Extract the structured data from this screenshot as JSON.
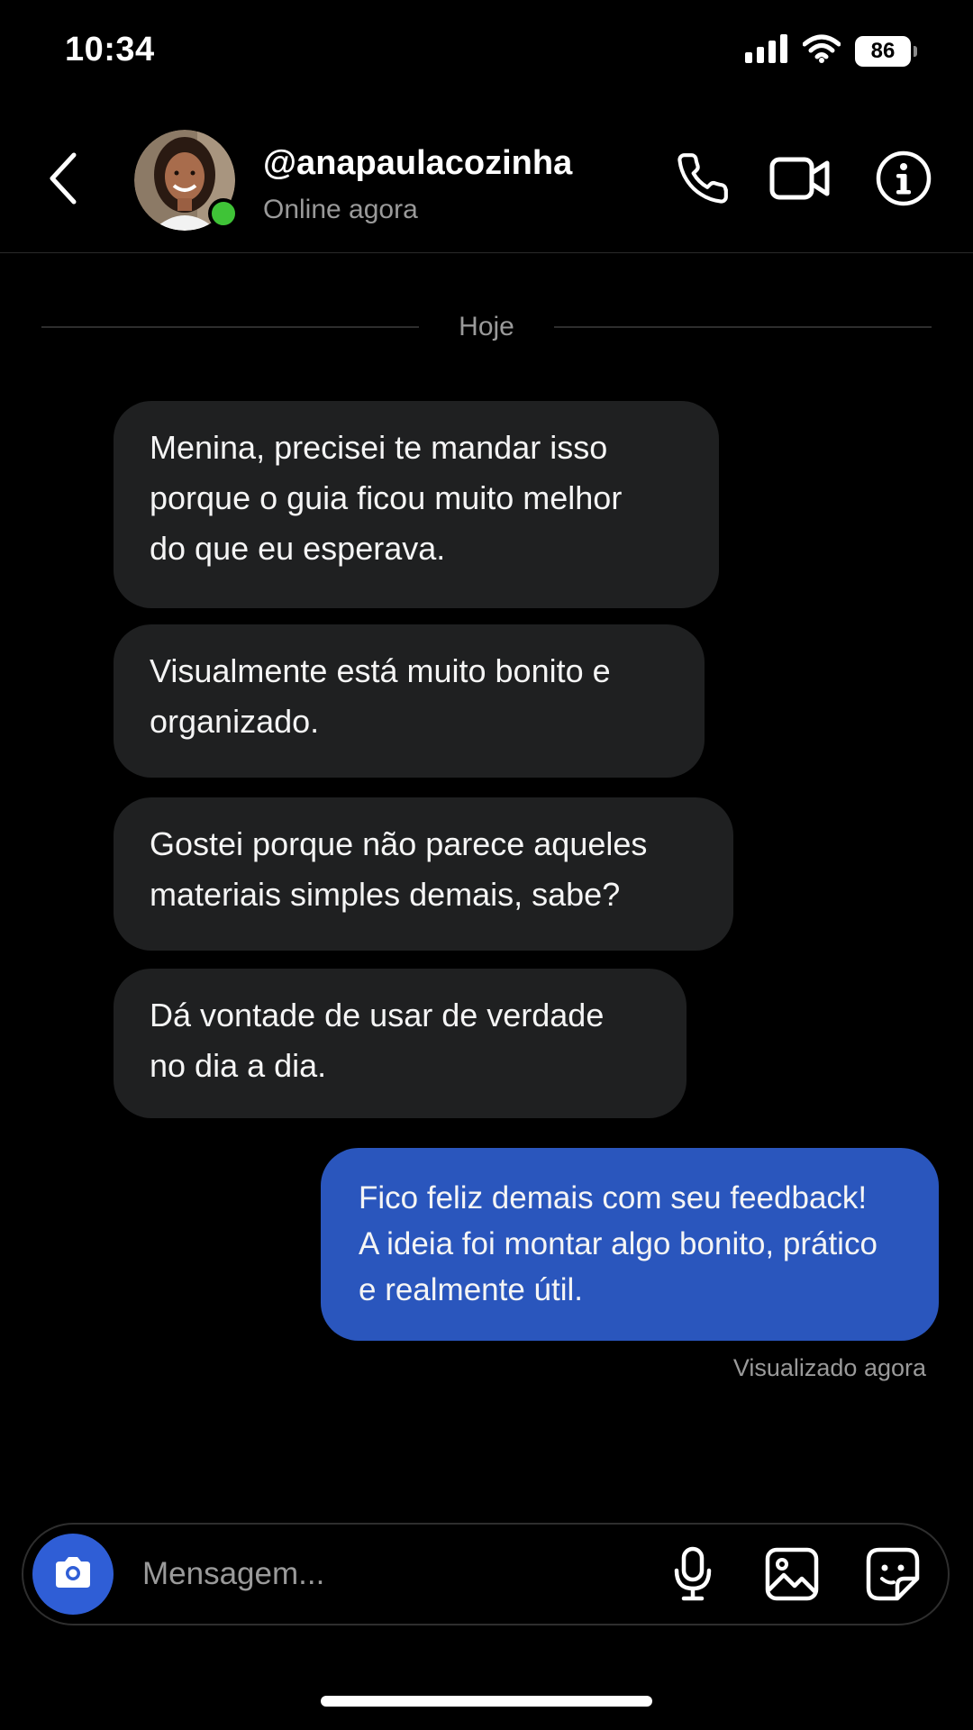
{
  "status_bar": {
    "time": "10:34",
    "battery_level": "86",
    "icons": [
      "signal-icon",
      "wifi-icon",
      "battery-icon"
    ]
  },
  "header": {
    "username": "@anapaulacozinha",
    "status": "Online agora",
    "online": true,
    "icons": [
      "back-chevron-icon",
      "phone-icon",
      "video-camera-icon",
      "info-icon"
    ]
  },
  "conversation": {
    "date_label": "Hoje",
    "messages": [
      {
        "direction": "received",
        "text": "Menina, precisei te mandar isso\nporque o guia ficou muito melhor\ndo que eu esperava."
      },
      {
        "direction": "received",
        "text": "Visualmente está muito bonito e\norganizado."
      },
      {
        "direction": "received",
        "text": "Gostei porque não parece aqueles\nmateriais simples demais, sabe?"
      },
      {
        "direction": "received",
        "text": "Dá vontade de usar de verdade\nno dia a dia."
      },
      {
        "direction": "sent",
        "text": "Fico feliz demais com seu feedback!\nA ideia foi montar algo bonito, prático\ne realmente útil."
      }
    ],
    "seen_status": "Visualizado agora"
  },
  "composer": {
    "placeholder": "Mensagem...",
    "value": "",
    "icons": [
      "camera-icon",
      "microphone-icon",
      "image-icon",
      "sticker-icon"
    ]
  },
  "colors": {
    "background": "#000000",
    "received_bubble": "#1f2021",
    "sent_bubble": "#2a56bd",
    "camera_button": "#2f5ed6",
    "online_dot": "#3fc337",
    "muted_text": "#9a9a9a"
  }
}
